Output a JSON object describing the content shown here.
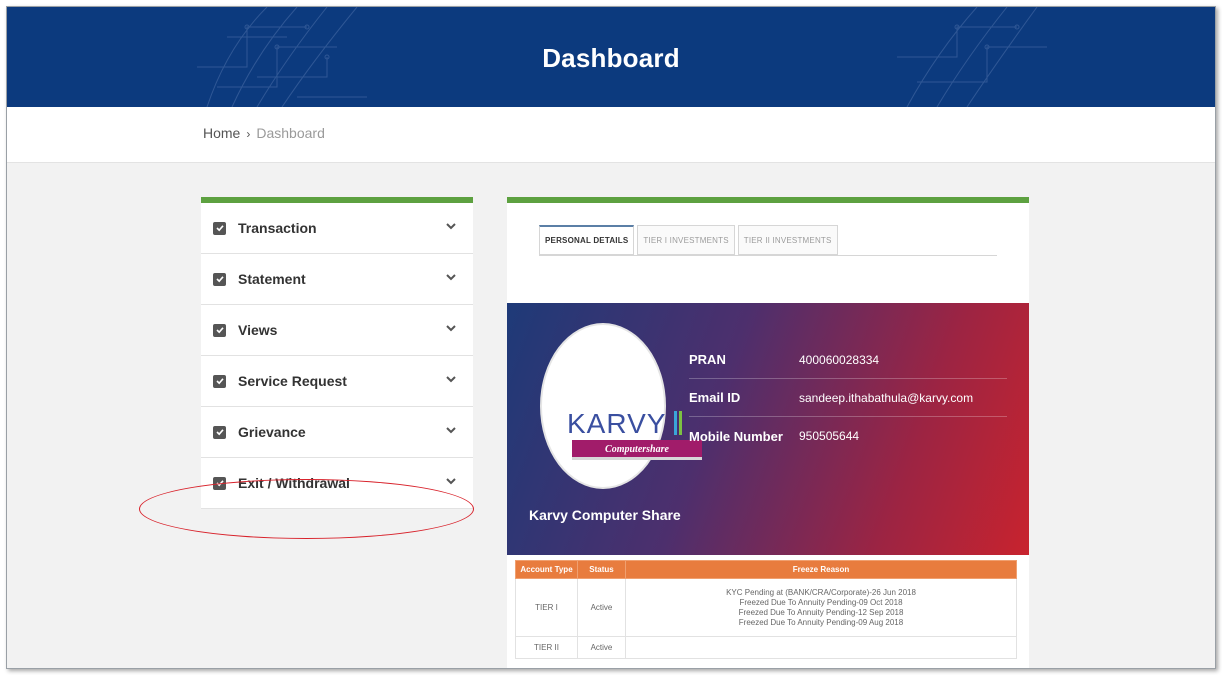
{
  "header": {
    "title": "Dashboard"
  },
  "breadcrumb": {
    "home": "Home",
    "separator": "›",
    "current": "Dashboard"
  },
  "sidebar": {
    "items": [
      {
        "label": "Transaction"
      },
      {
        "label": "Statement"
      },
      {
        "label": "Views"
      },
      {
        "label": "Service Request"
      },
      {
        "label": "Grievance"
      },
      {
        "label": "Exit / Withdrawal"
      }
    ]
  },
  "tabs": [
    {
      "label": "PERSONAL DETAILS",
      "active": true
    },
    {
      "label": "TIER I INVESTMENTS",
      "active": false
    },
    {
      "label": "TIER II INVESTMENTS",
      "active": false
    }
  ],
  "profile": {
    "logo_text": "KARVY",
    "logo_subtext": "Computershare",
    "company_name": "Karvy Computer Share",
    "fields": [
      {
        "key": "PRAN",
        "value": "400060028334"
      },
      {
        "key": "Email ID",
        "value": "sandeep.ithabathula@karvy.com"
      },
      {
        "key": "Mobile Number",
        "value": "950505644"
      }
    ]
  },
  "account_table": {
    "headers": [
      "Account Type",
      "Status",
      "Freeze Reason"
    ],
    "rows": [
      {
        "type": "TIER I",
        "status": "Active",
        "reasons": [
          "KYC Pending at (BANK/CRA/Corporate)-26 Jun 2018",
          "Freezed Due To Annuity Pending-09 Oct 2018",
          "Freezed Due To Annuity Pending-12 Sep 2018",
          "Freezed Due To Annuity Pending-09 Aug 2018"
        ]
      },
      {
        "type": "TIER II",
        "status": "Active",
        "reasons": []
      }
    ]
  },
  "colors": {
    "header_bg": "#0c3a7e",
    "accent_green": "#5da140",
    "table_header_orange": "#e87c3e",
    "highlight_oval": "#d8222b"
  }
}
